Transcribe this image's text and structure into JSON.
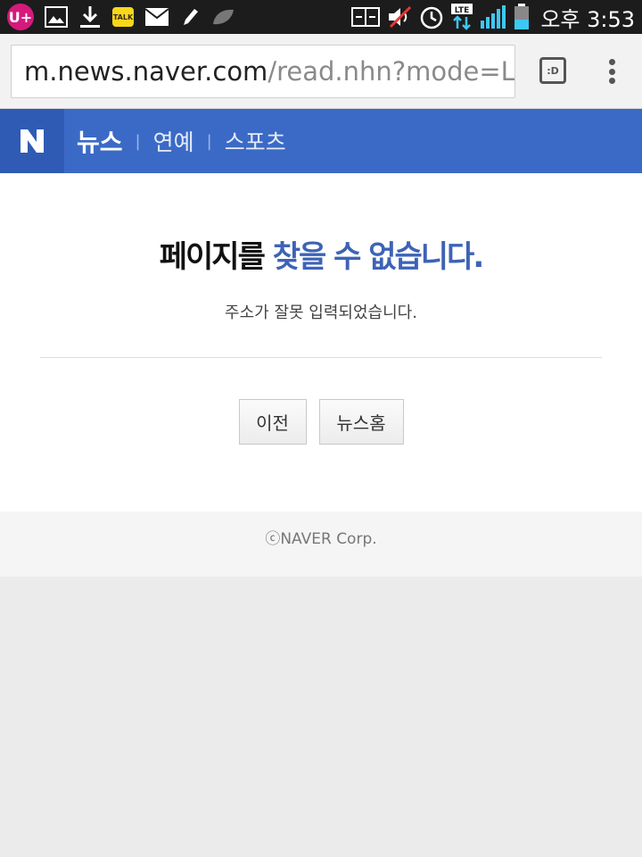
{
  "status_bar": {
    "carrier_badge": "U+",
    "kakao_label": "TALK",
    "network": "LTE",
    "time": "오후 3:53",
    "icons": [
      "uplus-icon",
      "gallery-icon",
      "download-icon",
      "kakaotalk-icon",
      "email-icon",
      "pen-icon",
      "leaf-icon",
      "screen-mirror-icon",
      "mute-icon",
      "alarm-icon",
      "lte-icon",
      "signal-icon",
      "battery-icon"
    ]
  },
  "browser": {
    "url_host": "m.news.naver.com",
    "url_path": "/read.nhn?mode=L",
    "tabs_label": ":D",
    "icons": [
      "tabs-icon",
      "overflow-menu-icon"
    ]
  },
  "header": {
    "logo": "N",
    "nav_main": "뉴스",
    "separator": "|",
    "nav_items": [
      "연예",
      "스포츠"
    ],
    "colors": {
      "bar": "#3b6ac6",
      "logo_bg": "#2f5bb5"
    }
  },
  "error": {
    "title_part1": "페이지를",
    "title_part2": "찾을 수 없습니다.",
    "description": "주소가 잘못 입력되었습니다.",
    "buttons": {
      "prev": "이전",
      "news_home": "뉴스홈"
    },
    "colors": {
      "title_accent": "#3d63b6"
    }
  },
  "footer": {
    "copyright": "ⓒNAVER Corp."
  }
}
